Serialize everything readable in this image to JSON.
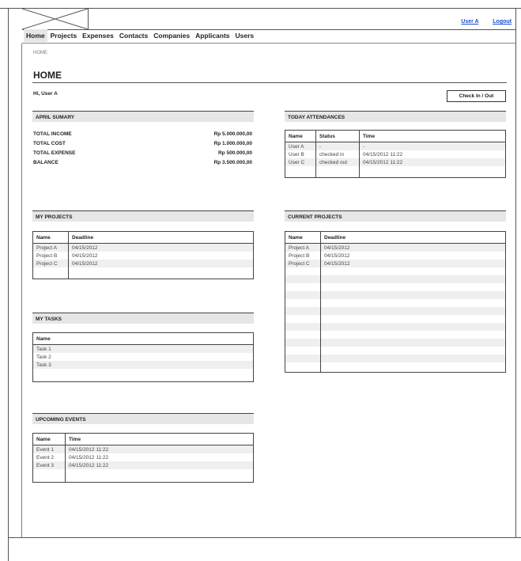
{
  "header": {
    "user_link": "User A",
    "logout_link": "Logout"
  },
  "nav": {
    "items": [
      "Home",
      "Projects",
      "Expenses",
      "Contacts",
      "Companies",
      "Applicants",
      "Users"
    ]
  },
  "breadcrumb": "HOME",
  "page": {
    "title": "HOME",
    "greeting": "Hi, User A",
    "checkin_label": "Check In / Out"
  },
  "april_summary": {
    "title": "APRIL SUMARY",
    "rows": [
      {
        "label": "TOTAL INCOME",
        "value": "Rp 5.000.000,00"
      },
      {
        "label": "TOTAL COST",
        "value": "Rp 1.000.000,00"
      },
      {
        "label": "TOTAL EXPENSE",
        "value": "Rp 500.000,00"
      },
      {
        "label": "BALANCE",
        "value": "Rp 3.500.000,00"
      }
    ]
  },
  "today_attendances": {
    "title": "TODAY ATTENDANCES",
    "columns": [
      "Name",
      "Status",
      "Time"
    ],
    "rows": [
      [
        "User A",
        "-",
        "-"
      ],
      [
        "User B",
        "checked in",
        "04/15/2012 11:22"
      ],
      [
        "User C",
        "checked out",
        "04/15/2012 11:22"
      ]
    ]
  },
  "my_projects": {
    "title": "MY PROJECTS",
    "columns": [
      "Name",
      "Deadline"
    ],
    "rows": [
      [
        "Project A",
        "04/15/2012"
      ],
      [
        "Project B",
        "04/15/2012"
      ],
      [
        "Project C",
        "04/15/2012"
      ]
    ]
  },
  "current_projects": {
    "title": "CURRENT PROJECTS",
    "columns": [
      "Name",
      "Deadline"
    ],
    "rows": [
      [
        "Project A",
        "04/15/2012"
      ],
      [
        "Project B",
        "04/15/2012"
      ],
      [
        "Project C",
        "04/15/2012"
      ]
    ]
  },
  "my_tasks": {
    "title": "MY TASKS",
    "columns": [
      "Name"
    ],
    "rows": [
      [
        "Task 1"
      ],
      [
        "Task 2"
      ],
      [
        "Task 3"
      ]
    ]
  },
  "upcoming_events": {
    "title": "UPCOMING EVENTS",
    "columns": [
      "Name",
      "Time"
    ],
    "rows": [
      [
        "Event 1",
        "04/15/2012 11:22"
      ],
      [
        "Event 2",
        "04/15/2012 11:22"
      ],
      [
        "Event 3",
        "04/15/2012 11:22"
      ]
    ]
  }
}
